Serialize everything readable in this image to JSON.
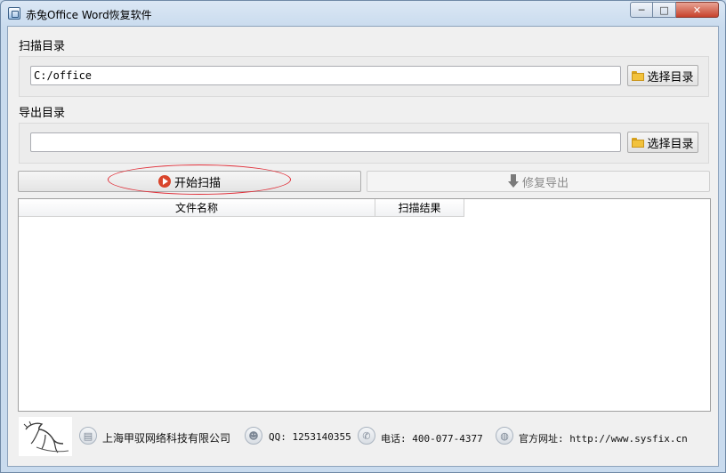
{
  "window": {
    "title": "赤兔Office Word恢复软件",
    "controls": {
      "minimize": "─",
      "maximize": "□",
      "close": "✕"
    }
  },
  "scan_dir": {
    "label": "扫描目录",
    "value": "C:/office",
    "placeholder": "",
    "browse_label": "选择目录"
  },
  "export_dir": {
    "label": "导出目录",
    "value": "",
    "placeholder": "",
    "browse_label": "选择目录"
  },
  "actions": {
    "start_scan": "开始扫描",
    "repair_export": "修复导出"
  },
  "table": {
    "columns": [
      "文件名称",
      "扫描结果"
    ],
    "rows": []
  },
  "footer": {
    "company": "上海甲驭网络科技有限公司",
    "qq": "QQ: 1253140355",
    "phone": "电话: 400-077-4377",
    "website": "官方网址: http://www.sysfix.cn"
  },
  "colors": {
    "highlight_ellipse": "#e0303a",
    "play_icon": "#d9442b",
    "folder_icon": "#f2c23c"
  }
}
